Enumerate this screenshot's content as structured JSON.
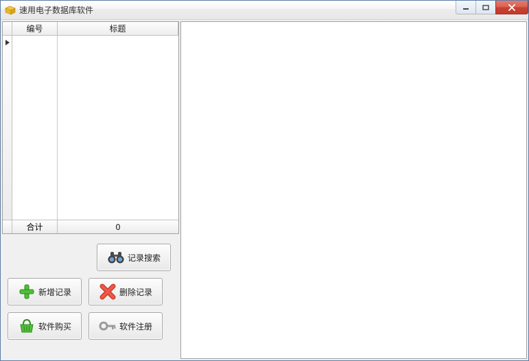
{
  "window": {
    "title": "速用电子数据库软件"
  },
  "grid": {
    "columns": {
      "id": "编号",
      "title": "标题"
    },
    "footer": {
      "label": "合计",
      "count": "0"
    }
  },
  "buttons": {
    "search": "记录搜索",
    "add": "新增记录",
    "delete": "删除记录",
    "buy": "软件购买",
    "register": "软件注册"
  }
}
